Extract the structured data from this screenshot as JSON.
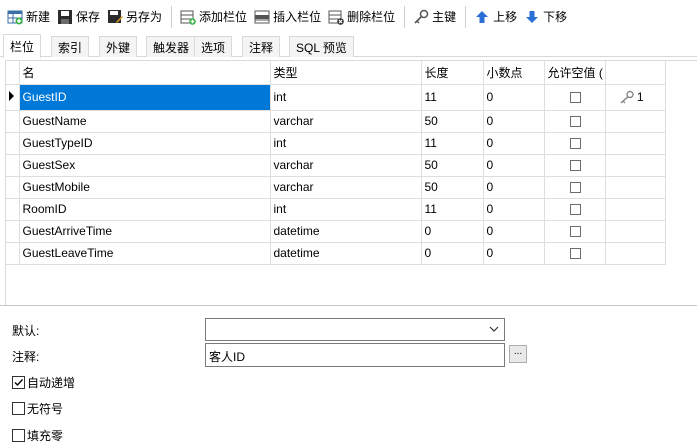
{
  "toolbar": {
    "new_label": "新建",
    "save_label": "保存",
    "save_as_label": "另存为",
    "add_column_label": "添加栏位",
    "insert_column_label": "插入栏位",
    "delete_column_label": "删除栏位",
    "primary_key_label": "主键",
    "move_up_label": "上移",
    "move_down_label": "下移"
  },
  "tabs": [
    "栏位",
    "索引",
    "外键",
    "触发器",
    "选项",
    "注释",
    "SQL 预览"
  ],
  "grid": {
    "headers": [
      "名",
      "类型",
      "长度",
      "小数点",
      "允许空值 (",
      ""
    ],
    "rows": [
      {
        "name": "GuestID",
        "type": "int",
        "length": "11",
        "decimals": "0",
        "key": "1"
      },
      {
        "name": "GuestName",
        "type": "varchar",
        "length": "50",
        "decimals": "0",
        "key": ""
      },
      {
        "name": "GuestTypeID",
        "type": "int",
        "length": "11",
        "decimals": "0",
        "key": ""
      },
      {
        "name": "GuestSex",
        "type": "varchar",
        "length": "50",
        "decimals": "0",
        "key": ""
      },
      {
        "name": "GuestMobile",
        "type": "varchar",
        "length": "50",
        "decimals": "0",
        "key": ""
      },
      {
        "name": "RoomID",
        "type": "int",
        "length": "11",
        "decimals": "0",
        "key": ""
      },
      {
        "name": "GuestArriveTime",
        "type": "datetime",
        "length": "0",
        "decimals": "0",
        "key": ""
      },
      {
        "name": "GuestLeaveTime",
        "type": "datetime",
        "length": "0",
        "decimals": "0",
        "key": ""
      }
    ]
  },
  "props": {
    "default_label": "默认:",
    "default_value": "",
    "comment_label": "注释:",
    "comment_value": "客人ID",
    "dots_label": "...",
    "auto_increment_label": "自动递增",
    "auto_increment_checked": true,
    "unsigned_label": "无符号",
    "unsigned_checked": false,
    "zerofill_label": "填充零",
    "zerofill_checked": false
  },
  "colors": {
    "selection": "#0078d7",
    "accent_blue": "#2a6fd6"
  }
}
